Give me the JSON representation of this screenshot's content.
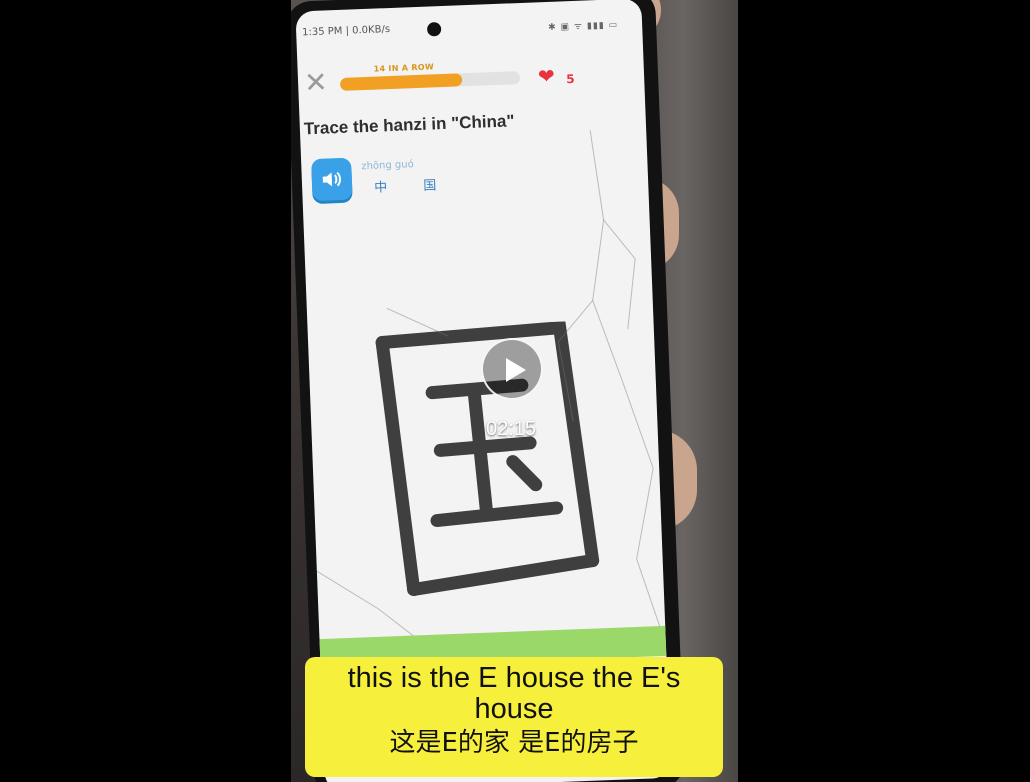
{
  "status_bar": {
    "time_speed": "1:35 PM | 0.0KB/s",
    "icons": "✱ ▣ ᯤ ▮▮▮ ▭"
  },
  "lesson": {
    "streak_label": "14 IN A ROW",
    "progress_fraction": 0.68,
    "lives": "5",
    "prompt": "Trace the hanzi in \"China\"",
    "pinyin": "zhōng guó",
    "hanzi": "中 国",
    "close_icon": "close-icon",
    "heart_icon": "heart-icon",
    "speaker_icon": "speaker-icon"
  },
  "video": {
    "duration": "02:15",
    "play_icon": "play-icon"
  },
  "caption": {
    "line_en": "this is the E house the E's house",
    "line_zh": "这是E的家 是E的房子"
  },
  "colors": {
    "caption_bg": "#f6ef3c",
    "streak": "#f2a023",
    "heart": "#e8343d",
    "speaker": "#3aa1e8"
  }
}
